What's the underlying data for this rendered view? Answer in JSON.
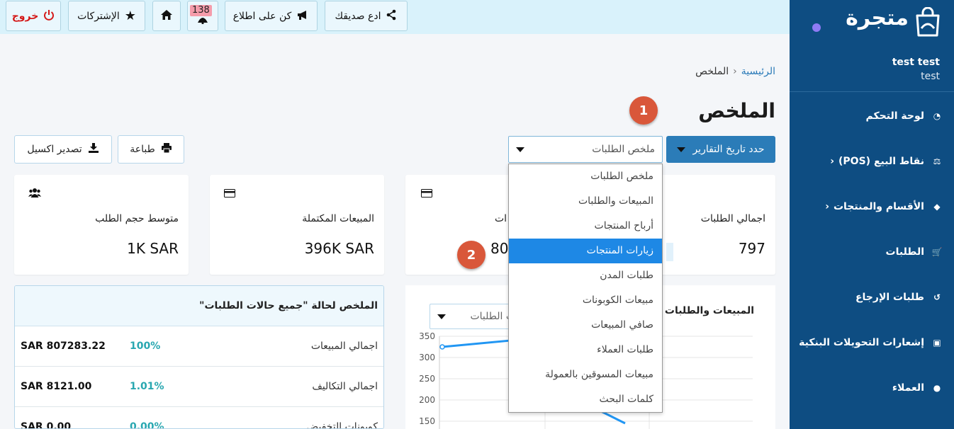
{
  "sidebar": {
    "brand": "متجرة",
    "user_name": "test test",
    "user_sub": "test",
    "items": [
      {
        "label": "لوحة التحكم",
        "icon": "dashboard-icon",
        "chev": ""
      },
      {
        "label": "نقاط البيع (POS)",
        "icon": "scale-icon",
        "chev": "‹"
      },
      {
        "label": "الأقسام والمنتجات",
        "icon": "tag-icon",
        "chev": "‹"
      },
      {
        "label": "الطلبات",
        "icon": "cart-icon",
        "chev": ""
      },
      {
        "label": "طلبات الإرجاع",
        "icon": "undo-icon",
        "chev": ""
      },
      {
        "label": "إشعارات التحويلات البنكية",
        "icon": "money-icon",
        "chev": ""
      },
      {
        "label": "العملاء",
        "icon": "user-icon",
        "chev": ""
      }
    ]
  },
  "topbar": {
    "invite": "ادع صديقك",
    "stay_informed": "كن على اطلاع",
    "notifications_count": "138",
    "subscriptions": "الإشتركات",
    "logout": "خروج"
  },
  "breadcrumb": {
    "home": "الرئيسية",
    "current": "الملخص"
  },
  "page_title": "الملخص",
  "steps": {
    "one": "1",
    "two": "2"
  },
  "filters": {
    "date_button": "حدد تاريخ التقارير",
    "report_select": "ملخص الطلبات",
    "print": "طباعة",
    "export": "تصدير اكسيل"
  },
  "dropdown": {
    "options": [
      "ملخص الطلبات",
      "المبيعات والطلبات",
      "أرباح المنتجات",
      "زيارات المنتجات",
      "طلبات المدن",
      "مبيعات الكوبونات",
      "صافي المبيعات",
      "طلبات العملاء",
      "مبيعات المسوقين بالعمولة",
      "كلمات البحث"
    ],
    "active_index": 3
  },
  "cards": [
    {
      "label": "اجمالي الطلبات",
      "value": "797"
    },
    {
      "label": "ات",
      "value": "80"
    },
    {
      "label": "المبيعات المكتملة",
      "value": "396K SAR"
    },
    {
      "label": "متوسط حجم الطلب",
      "value": "1K SAR"
    }
  ],
  "summary": {
    "title": "الملخص لحالة \"جميع حالات الطلبات\"",
    "rows": [
      {
        "name": "اجمالي المبيعات",
        "pct": "100%",
        "amount": "SAR 807283.22"
      },
      {
        "name": "اجمالي التكاليف",
        "pct": "1.01%",
        "amount": "SAR 8121.00"
      },
      {
        "name": "كوبونات التخفيض",
        "pct": "0.00%",
        "amount": "SAR 0.00"
      }
    ]
  },
  "chart": {
    "title": "المبيعات والطلبات",
    "select": "لات الطلبات"
  },
  "chart_data": {
    "type": "line",
    "ylim": [
      150,
      350
    ],
    "y_ticks": [
      "350",
      "300",
      "250",
      "200",
      "150"
    ],
    "series_color": "#2196f3",
    "points": [
      [
        0,
        325
      ],
      [
        1,
        340
      ],
      [
        2,
        220
      ],
      [
        3,
        145
      ]
    ]
  }
}
